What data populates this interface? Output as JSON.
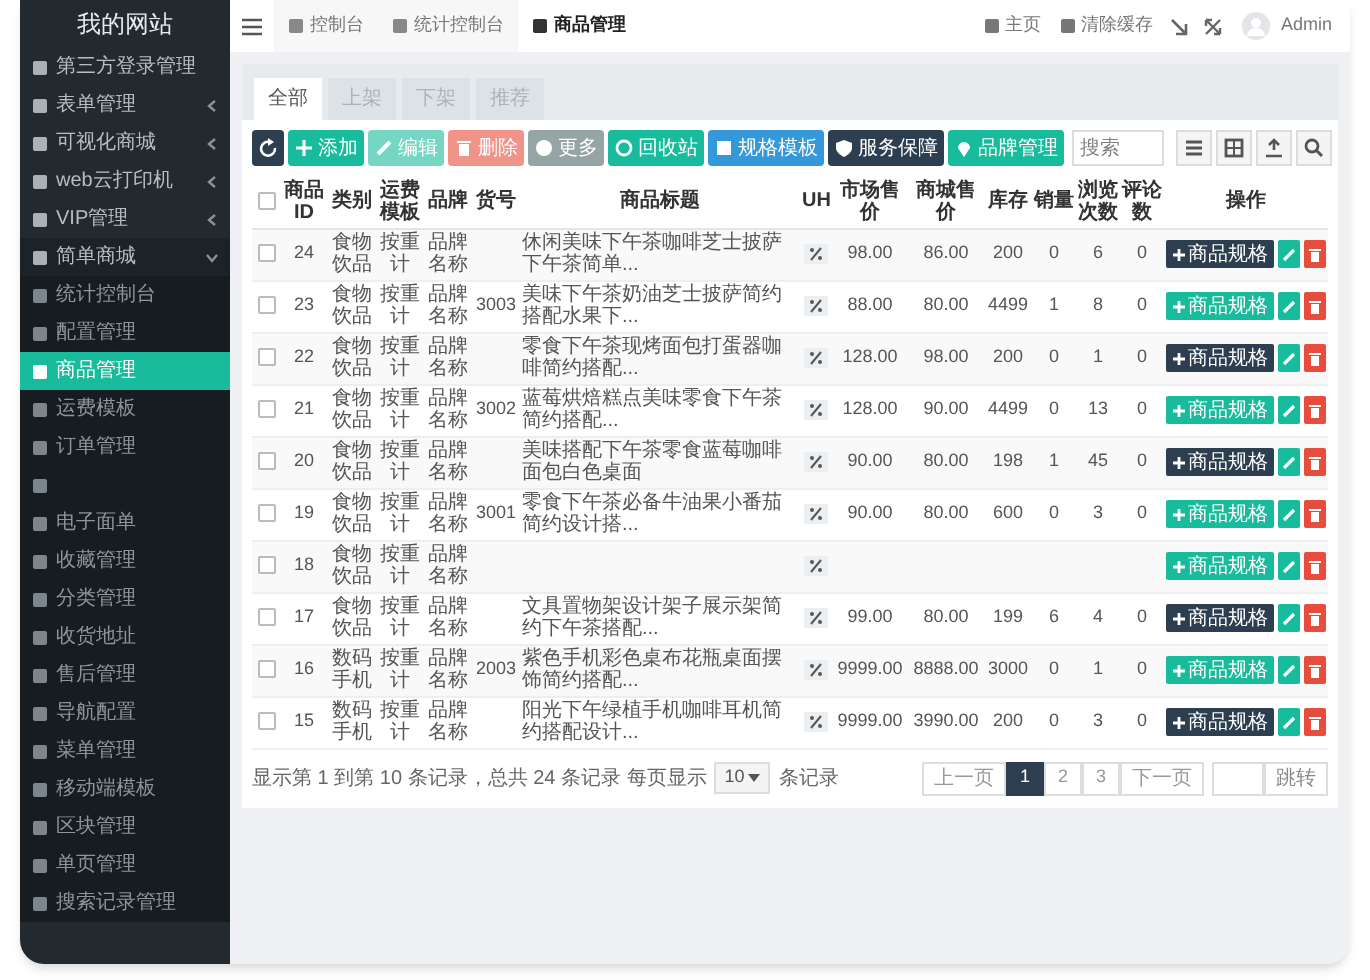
{
  "sidebar": {
    "title": "我的网站",
    "items": [
      {
        "label": "第三方登录管理",
        "expanded": false,
        "has_arrow": false
      },
      {
        "label": "表单管理",
        "expanded": false,
        "has_arrow": true
      },
      {
        "label": "可视化商城",
        "expanded": false,
        "has_arrow": true
      },
      {
        "label": "web云打印机",
        "expanded": false,
        "has_arrow": true
      },
      {
        "label": "VIP管理",
        "expanded": false,
        "has_arrow": true
      },
      {
        "label": "简单商城",
        "expanded": true,
        "has_arrow": true,
        "children": [
          {
            "label": "统计控制台",
            "selected": false
          },
          {
            "label": "配置管理",
            "selected": false
          },
          {
            "label": "商品管理",
            "selected": true
          },
          {
            "label": "运费模板",
            "selected": false
          },
          {
            "label": "订单管理",
            "selected": false
          },
          {
            "selected": false
          },
          {
            "label": "电子面单",
            "selected": false
          },
          {
            "label": "收藏管理",
            "selected": false
          },
          {
            "label": "分类管理",
            "selected": false
          },
          {
            "label": "收货地址",
            "selected": false
          },
          {
            "label": "售后管理",
            "selected": false
          },
          {
            "label": "导航配置",
            "selected": false
          },
          {
            "label": "菜单管理",
            "selected": false
          },
          {
            "label": "移动端模板",
            "selected": false
          },
          {
            "label": "区块管理",
            "selected": false
          },
          {
            "label": "单页管理",
            "selected": false
          },
          {
            "label": "搜索记录管理",
            "selected": false
          }
        ]
      }
    ]
  },
  "top_nav": {
    "tabs": [
      {
        "label": "控制台",
        "selected": false
      },
      {
        "label": "统计控制台",
        "selected": false
      },
      {
        "label": "商品管理",
        "selected": true
      }
    ],
    "links": [
      "主页",
      "清除缓存"
    ],
    "user": "Admin"
  },
  "tabs": [
    {
      "label": "全部",
      "selected": true
    },
    {
      "label": "上架",
      "selected": false
    },
    {
      "label": "下架",
      "selected": false
    },
    {
      "label": "推荐",
      "selected": false
    }
  ],
  "toolbar": {
    "buttons": [
      {
        "kind": "dark",
        "disabled": false
      },
      {
        "label": "添加",
        "kind": "success",
        "disabled": false
      },
      {
        "label": "编辑",
        "kind": "success",
        "disabled": true
      },
      {
        "label": "删除",
        "kind": "danger",
        "disabled": true
      },
      {
        "label": "更多",
        "kind": "gray",
        "disabled": false
      },
      {
        "label": "回收站",
        "kind": "success",
        "disabled": false
      },
      {
        "label": "规格模板",
        "kind": "info",
        "disabled": false
      },
      {
        "label": "服务保障",
        "kind": "dark",
        "disabled": false
      },
      {
        "label": "品牌管理",
        "kind": "success",
        "disabled": false
      }
    ],
    "search": {
      "placeholder": "搜索"
    }
  },
  "table": {
    "all_checked": false,
    "columns": [
      "商品ID",
      "类别",
      "运费模板",
      "品牌",
      "货号",
      "商品标题",
      "UH",
      "市场售价",
      "商城售价",
      "库存",
      "销量",
      "浏览次数",
      "评论数",
      "操作"
    ],
    "rows": [
      {
        "checked": false,
        "id": "24",
        "category": "食物饮品",
        "shipping": "按重计",
        "brand": "品牌名称",
        "title": "休闲美味下午茶咖啡芝士披萨下午茶简单...",
        "market_price": "98.00",
        "shop_price": "86.00",
        "stock": "200",
        "sales": "0",
        "views": "6",
        "comments": "0",
        "spec_label": "商品规格",
        "kind": "dark"
      },
      {
        "checked": false,
        "id": "23",
        "category": "食物饮品",
        "shipping": "按重计",
        "brand": "品牌名称",
        "sku": "3003",
        "title": "美味下午茶奶油芝士披萨简约搭配水果下...",
        "market_price": "88.00",
        "shop_price": "80.00",
        "stock": "4499",
        "sales": "1",
        "views": "8",
        "comments": "0",
        "spec_label": "商品规格",
        "kind": "success"
      },
      {
        "checked": false,
        "id": "22",
        "category": "食物饮品",
        "shipping": "按重计",
        "brand": "品牌名称",
        "title": "零食下午茶现烤面包打蛋器咖啡简约搭配...",
        "market_price": "128.00",
        "shop_price": "98.00",
        "stock": "200",
        "sales": "0",
        "views": "1",
        "comments": "0",
        "spec_label": "商品规格",
        "kind": "dark"
      },
      {
        "checked": false,
        "id": "21",
        "category": "食物饮品",
        "shipping": "按重计",
        "brand": "品牌名称",
        "sku": "3002",
        "title": "蓝莓烘焙糕点美味零食下午茶简约搭配...",
        "market_price": "128.00",
        "shop_price": "90.00",
        "stock": "4499",
        "sales": "0",
        "views": "13",
        "comments": "0",
        "spec_label": "商品规格",
        "kind": "success"
      },
      {
        "checked": false,
        "id": "20",
        "category": "食物饮品",
        "shipping": "按重计",
        "brand": "品牌名称",
        "title": "美味搭配下午茶零食蓝莓咖啡面包白色桌面",
        "market_price": "90.00",
        "shop_price": "80.00",
        "stock": "198",
        "sales": "1",
        "views": "45",
        "comments": "0",
        "spec_label": "商品规格",
        "kind": "dark"
      },
      {
        "checked": false,
        "id": "19",
        "category": "食物饮品",
        "shipping": "按重计",
        "brand": "品牌名称",
        "sku": "3001",
        "title": "零食下午茶必备牛油果小番茄简约设计搭...",
        "market_price": "90.00",
        "shop_price": "80.00",
        "stock": "600",
        "sales": "0",
        "views": "3",
        "comments": "0",
        "spec_label": "商品规格",
        "kind": "success"
      },
      {
        "checked": false,
        "id": "18",
        "category": "食物饮品",
        "shipping": "按重计",
        "brand": "品牌名称",
        "spec_label": "商品规格",
        "kind": "success"
      },
      {
        "checked": false,
        "id": "17",
        "category": "食物饮品",
        "shipping": "按重计",
        "brand": "品牌名称",
        "title": "文具置物架设计架子展示架简约下午茶搭配...",
        "market_price": "99.00",
        "shop_price": "80.00",
        "stock": "199",
        "sales": "6",
        "views": "4",
        "comments": "0",
        "spec_label": "商品规格",
        "kind": "dark"
      },
      {
        "checked": false,
        "id": "16",
        "category": "数码手机",
        "shipping": "按重计",
        "brand": "品牌名称",
        "sku": "2003",
        "title": "紫色手机彩色桌布花瓶桌面摆饰简约搭配...",
        "market_price": "9999.00",
        "shop_price": "8888.00",
        "stock": "3000",
        "sales": "0",
        "views": "1",
        "comments": "0",
        "spec_label": "商品规格",
        "kind": "success"
      },
      {
        "checked": false,
        "id": "15",
        "category": "数码手机",
        "shipping": "按重计",
        "brand": "品牌名称",
        "title": "阳光下午绿植手机咖啡耳机简约搭配设计...",
        "market_price": "9999.00",
        "shop_price": "3990.00",
        "stock": "200",
        "sales": "0",
        "views": "3",
        "comments": "0",
        "spec_label": "商品规格",
        "kind": "dark"
      }
    ]
  },
  "footer": {
    "summary": "显示第 1 到第 10 条记录，总共 24 条记录 每页显示",
    "page_size": "10",
    "suffix": "条记录"
  },
  "pagination": {
    "prev": "上一页",
    "pages": [
      {
        "label": "1",
        "selected": true
      },
      {
        "label": "2",
        "selected": false
      },
      {
        "label": "3",
        "selected": false
      }
    ],
    "next": "下一页",
    "go": "跳转"
  }
}
